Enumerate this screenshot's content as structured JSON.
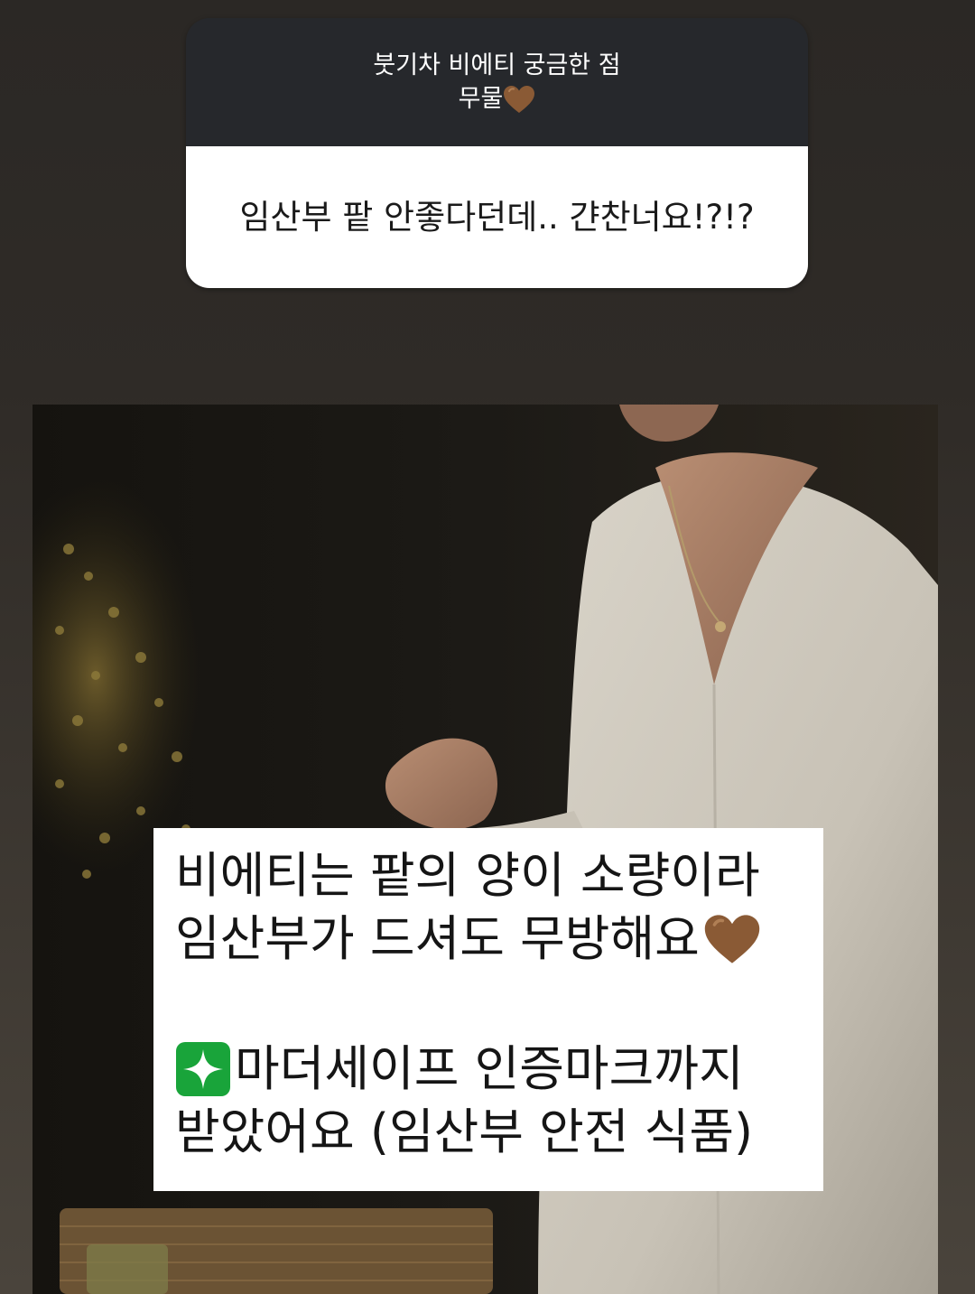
{
  "question_sticker": {
    "header_line1": "붓기차 비에티 궁금한 점",
    "header_line2": "무물",
    "question": "임산부 팥 안좋다던데.. 갼찬너요!?!?"
  },
  "answer": {
    "line1": "비에티는 팥의 양이 소량이라",
    "line2": "임산부가 드셔도 무방해요",
    "line3": "마더세이프 인증마크까지",
    "line4": "받았어요 (임산부 안전 식품)"
  },
  "icons": {
    "heart": "brown-heart-icon",
    "sparkle": "sparkles-icon"
  },
  "colors": {
    "heart": "#8a5a35",
    "sparkle_bg": "#19a43a",
    "header_bg": "#26282c"
  }
}
